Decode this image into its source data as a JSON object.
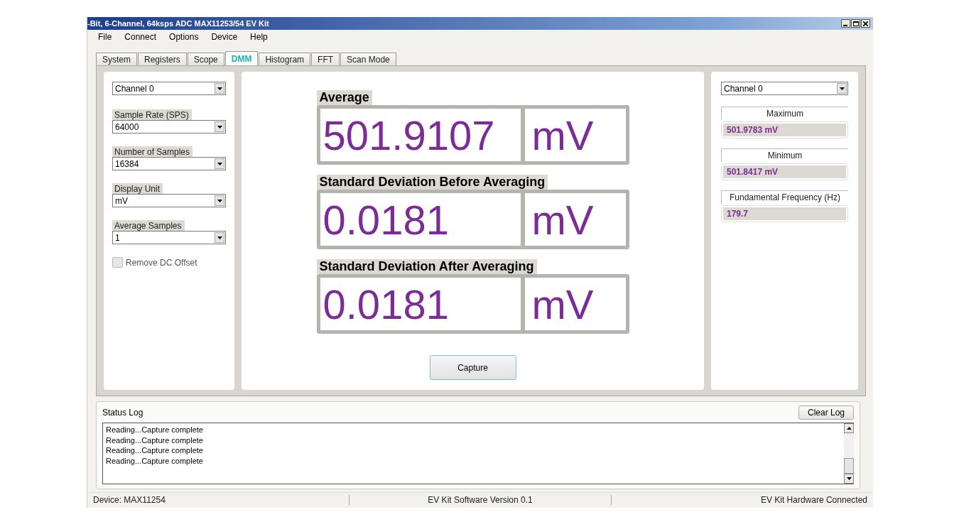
{
  "window": {
    "title": "-Bit, 6-Channel, 64ksps ADC MAX11253/54 EV Kit"
  },
  "menu": [
    "File",
    "Connect",
    "Options",
    "Device",
    "Help"
  ],
  "tabs": [
    {
      "label": "System",
      "selected": false
    },
    {
      "label": "Registers",
      "selected": false
    },
    {
      "label": "Scope",
      "selected": false
    },
    {
      "label": "DMM",
      "selected": true
    },
    {
      "label": "Histogram",
      "selected": false
    },
    {
      "label": "FFT",
      "selected": false
    },
    {
      "label": "Scan Mode",
      "selected": false
    }
  ],
  "settings": {
    "channel": "Channel 0",
    "fields": [
      {
        "label": "Sample Rate (SPS)",
        "value": "64000"
      },
      {
        "label": "Number of Samples",
        "value": "16384"
      },
      {
        "label": "Display Unit",
        "value": "mV"
      },
      {
        "label": "Average Samples",
        "value": "1"
      }
    ],
    "remove_dc_offset": {
      "label": "Remove DC Offset",
      "checked": false,
      "disabled": true
    }
  },
  "readings": [
    {
      "title": "Average",
      "value": "501.9107",
      "unit": "mV"
    },
    {
      "title": "Standard Deviation Before Averaging",
      "value": "0.0181",
      "unit": "mV"
    },
    {
      "title": "Standard Deviation After Averaging",
      "value": "0.0181",
      "unit": "mV"
    }
  ],
  "capture_button": "Capture",
  "statistics": {
    "channel": "Channel 0",
    "items": [
      {
        "label": "Maximum",
        "value": "501.9783 mV"
      },
      {
        "label": "Minimum",
        "value": "501.8417 mV"
      },
      {
        "label": "Fundamental Frequency (Hz)",
        "value": "179.7"
      }
    ]
  },
  "status_log": {
    "title": "Status Log",
    "clear_button": "Clear Log",
    "lines": [
      "Reading...Capture complete",
      "Reading...Capture complete",
      "Reading...Capture complete",
      "Reading...Capture complete"
    ]
  },
  "status_bar": [
    "Device: MAX11254",
    "EV Kit Software Version 0.1",
    "EV Kit Hardware Connected"
  ]
}
